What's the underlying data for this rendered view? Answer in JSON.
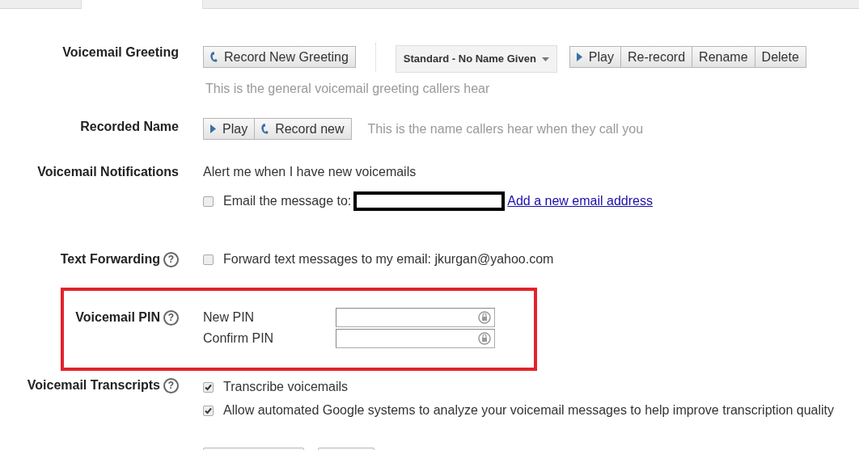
{
  "tabs": [
    {
      "selected": false
    },
    {
      "selected": true
    },
    {
      "selected": false
    }
  ],
  "greeting": {
    "label": "Voicemail Greeting",
    "record_button": "Record New Greeting",
    "dropdown": "Standard - No Name Given",
    "buttons": [
      "Play",
      "Re-record",
      "Rename",
      "Delete"
    ],
    "caption": "This is the general voicemail greeting callers hear"
  },
  "recorded_name": {
    "label": "Recorded Name",
    "buttons": [
      "Play",
      "Record new"
    ],
    "caption": "This is the name callers hear when they call you"
  },
  "notifications": {
    "label": "Voicemail Notifications",
    "intro": "Alert me when I have new voicemails",
    "email_option": {
      "label": "Email the message to:",
      "checked": false
    },
    "link": "Add a new email address"
  },
  "text_forwarding": {
    "label": "Text Forwarding",
    "help": "?",
    "option": {
      "label": "Forward text messages to my email: jkurgan@yahoo.com",
      "checked": false
    }
  },
  "pin": {
    "label": "Voicemail PIN",
    "help": "?",
    "fields": [
      "New PIN",
      "Confirm PIN"
    ]
  },
  "transcripts": {
    "label": "Voicemail Transcripts",
    "help": "?",
    "options": [
      {
        "label": "Transcribe voicemails",
        "checked": true
      },
      {
        "label": "Allow automated Google systems to analyze your voicemail messages to help improve transcription quality",
        "checked": true
      }
    ]
  }
}
